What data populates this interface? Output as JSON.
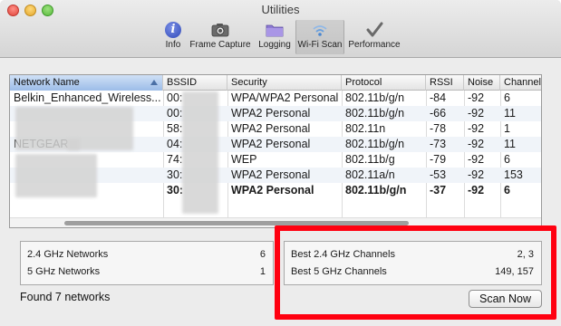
{
  "window": {
    "title": "Utilities"
  },
  "toolbar": {
    "items": [
      {
        "label": "Info",
        "icon": "info-icon"
      },
      {
        "label": "Frame Capture",
        "icon": "camera-icon"
      },
      {
        "label": "Logging",
        "icon": "folder-icon"
      },
      {
        "label": "Wi-Fi Scan",
        "icon": "wifi-icon",
        "selected": true
      },
      {
        "label": "Performance",
        "icon": "checkmark-icon"
      }
    ]
  },
  "table": {
    "columns": [
      "Network Name",
      "BSSID",
      "Security",
      "Protocol",
      "RSSI",
      "Noise",
      "Channel"
    ],
    "sorted_column": "Network Name",
    "rows": [
      {
        "name": "Belkin_Enhanced_Wireless...",
        "bssid": "00:",
        "security": "WPA/WPA2 Personal",
        "protocol": "802.11b/g/n",
        "rssi": "-84",
        "noise": "-92",
        "channel": "6",
        "bold": false
      },
      {
        "name": "",
        "bssid": "00:",
        "security": "WPA2 Personal",
        "protocol": "802.11b/g/n",
        "rssi": "-66",
        "noise": "-92",
        "channel": "11",
        "bold": false
      },
      {
        "name": "",
        "bssid": "58:",
        "security": "WPA2 Personal",
        "protocol": "802.11n",
        "rssi": "-78",
        "noise": "-92",
        "channel": "1",
        "bold": false
      },
      {
        "name": "NETGEAR",
        "bssid": "04:",
        "security": "WPA2 Personal",
        "protocol": "802.11b/g/n",
        "rssi": "-73",
        "noise": "-92",
        "channel": "11",
        "bold": false
      },
      {
        "name": "",
        "bssid": "74:",
        "security": "WEP",
        "protocol": "802.11b/g",
        "rssi": "-79",
        "noise": "-92",
        "channel": "6",
        "bold": false
      },
      {
        "name": "",
        "bssid": "30:",
        "security": "WPA2 Personal",
        "protocol": "802.11a/n",
        "rssi": "-53",
        "noise": "-92",
        "channel": "153",
        "bold": false
      },
      {
        "name": "",
        "bssid": "30:",
        "security": "WPA2 Personal",
        "protocol": "802.11b/g/n",
        "rssi": "-37",
        "noise": "-92",
        "channel": "6",
        "bold": true
      }
    ]
  },
  "summary": {
    "left": [
      {
        "label": "2.4 GHz Networks",
        "value": "6"
      },
      {
        "label": "5 GHz Networks",
        "value": "1"
      }
    ],
    "right": [
      {
        "label": "Best 2.4 GHz Channels",
        "value": "2, 3"
      },
      {
        "label": "Best 5 GHz Channels",
        "value": "149, 157"
      }
    ]
  },
  "status": {
    "found_text": "Found 7 networks"
  },
  "actions": {
    "scan_now_label": "Scan Now"
  },
  "colors": {
    "highlight": "#ff0010",
    "sorted_header": "#9cbde8"
  }
}
